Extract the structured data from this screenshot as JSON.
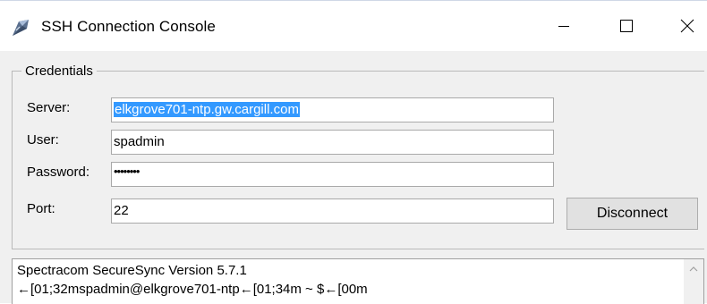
{
  "window": {
    "title": "SSH Connection Console",
    "icon": "ssh-app-icon",
    "controls": {
      "minimize": "minimize-icon",
      "maximize": "maximize-icon",
      "close": "close-icon"
    }
  },
  "credentials": {
    "legend": "Credentials",
    "server_label": "Server:",
    "server_value": "elkgrove701-ntp.gw.cargill.com",
    "user_label": "User:",
    "user_value": "spadmin",
    "password_label": "Password:",
    "password_value": "••••••••",
    "port_label": "Port:",
    "port_value": "22",
    "disconnect_label": "Disconnect"
  },
  "console": {
    "lines": [
      "Spectracom SecureSync Version 5.7.1",
      "←[01;32mspadmin@elkgrove701-ntp←[01;34m ~ $←[00m"
    ]
  },
  "colors": {
    "selection": "#3399ff",
    "window_bg": "#f0f0f0",
    "button_bg": "#e1e1e1"
  }
}
